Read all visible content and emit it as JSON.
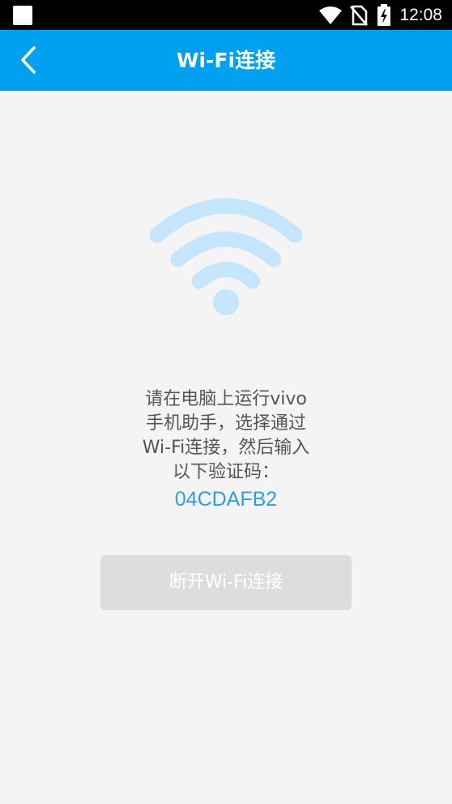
{
  "status_bar": {
    "time": "12:08",
    "icons": [
      "notification-square-icon",
      "wifi-signal-icon",
      "no-sim-icon",
      "battery-charging-icon"
    ]
  },
  "app_bar": {
    "title": "Wi-Fi连接",
    "back_icon": "chevron-left-icon",
    "background": "#00a0f0"
  },
  "main": {
    "illustration_icon": "wifi-icon",
    "illustration_color": "#c4e5fb",
    "instruction_lines": [
      "请在电脑上运行vivo",
      "手机助手，选择通过",
      "Wi-Fi连接，然后输入",
      "以下验证码："
    ],
    "verification_code": "04CDAFB2",
    "code_color": "#2d9ee6",
    "disconnect_label": "断开Wi-Fi连接"
  }
}
